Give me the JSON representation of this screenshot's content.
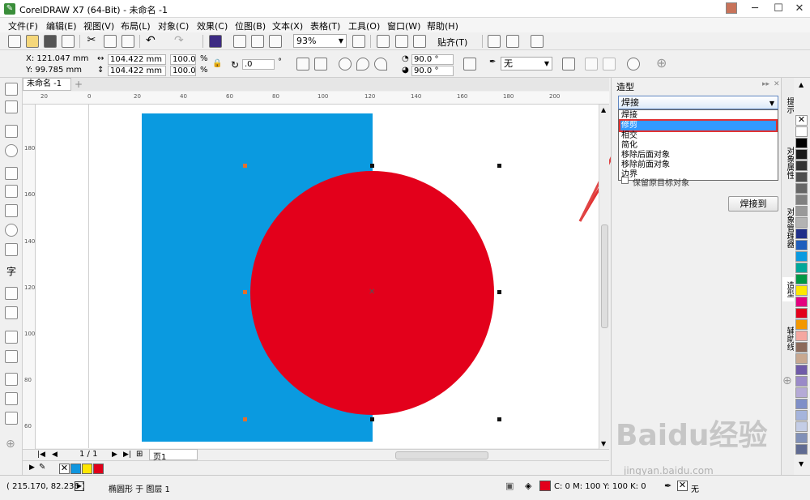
{
  "window": {
    "title": "CorelDRAW X7 (64-Bit) - 未命名 -1",
    "app_icon": "coreldraw-icon"
  },
  "menu": [
    "文件(F)",
    "编辑(E)",
    "视图(V)",
    "布局(L)",
    "对象(C)",
    "效果(C)",
    "位图(B)",
    "文本(X)",
    "表格(T)",
    "工具(O)",
    "窗口(W)",
    "帮助(H)"
  ],
  "toolbar": {
    "zoom": "93%",
    "snap_label": "贴齐(T)"
  },
  "properties": {
    "x": "X: 121.047 mm",
    "y": "Y: 99.785 mm",
    "width": "104.422 mm",
    "height": "104.422 mm",
    "scale_w": "100.0",
    "scale_h": "100.0",
    "percent": "%",
    "rotation": ".0",
    "degree": "°",
    "angle1": "90.0 °",
    "angle2": "90.0 °",
    "outline": "无"
  },
  "doc_tab": "未命名 -1",
  "hruler_ticks": [
    "20",
    "0",
    "20",
    "40",
    "60",
    "80",
    "100",
    "120",
    "140",
    "160",
    "180",
    "200"
  ],
  "vruler_ticks": [
    "180",
    "160",
    "140",
    "120",
    "100",
    "80",
    "60",
    "40"
  ],
  "page": {
    "counter": "1 / 1",
    "page_tab": "页1"
  },
  "palette_swatches": [
    "#1096df",
    "#ffe600",
    "#e0001a"
  ],
  "docker": {
    "title": "造型",
    "selected": "焊接",
    "options": [
      "焊接",
      "修剪",
      "相交",
      "简化",
      "移除后面对象",
      "移除前面对象",
      "边界"
    ],
    "highlighted_index": 1,
    "checkbox_label": "保留原目标对象",
    "apply_button": "焊接到"
  },
  "side_tabs": [
    "提示",
    "对象属性",
    "对象管理器",
    "造型",
    "辅助线"
  ],
  "status": {
    "coords": "( 215.170, 82.236 )",
    "object_info": "椭圆形 于 图层 1",
    "fill_info": "C: 0 M: 100 Y: 100 K: 0",
    "outline_info": "无"
  },
  "watermark": {
    "text": "Baidu经验",
    "url": "jingyan.baidu.com"
  },
  "colors": {
    "blue_rect": "#0a9ae0",
    "red_circle": "#e3001b",
    "selection_blue": "#3399ff",
    "highlight_red": "#e23232"
  }
}
